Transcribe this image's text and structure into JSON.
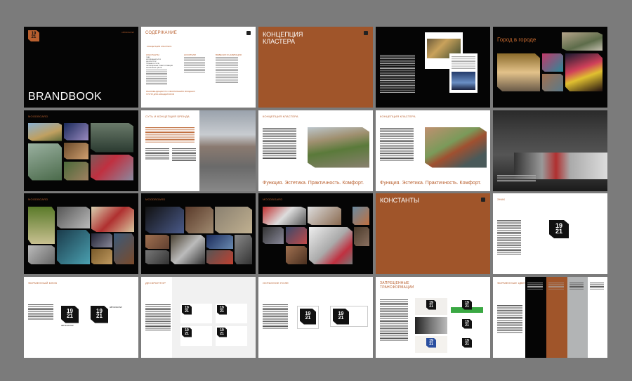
{
  "brand": {
    "logo_text": [
      "19",
      "21"
    ],
    "name": "АВТОКЛАСТЕР"
  },
  "colors": {
    "accent": "#b9602f",
    "rust": "#a0552a",
    "black": "#050505",
    "gray": "#b2b4b5"
  },
  "slides": {
    "cover": {
      "title": "BRANDBOOK",
      "tag": "АВТОКЛАСТЕР"
    },
    "toc": {
      "title": "СОДЕРЖАНИЕ",
      "concept": "КОНЦЕПЦИЯ КЛАСТЕРА",
      "sections": [
        {
          "label": "КОНСТАНТЫ",
          "items": [
            "ЗНАК",
            "ФИРМЕННЫЙ БЛОК",
            "ДЕСКРИПТОР",
            "ОХРАННОЕ ПОЛЕ",
            "ЗАПРЕЩЕННЫЕ ТРАНСФОРМАЦИИ",
            "ФИРМЕННЫЕ ЦВЕТА"
          ]
        },
        {
          "label": "НОСИТЕЛИ"
        },
        {
          "label": "ВЫВЕСКИ И НАВИГАЦИЯ"
        }
      ],
      "recommendations": "РЕКОМЕНДАЦИИ ПО ОФОРМЛЕНИЮ ВХОДНЫХ ГРУПП ДЛЯ АРЕНДАТОРОВ"
    },
    "concept_cover": {
      "title": "КОНЦЕПЦИЯ КЛАСТЕРА"
    },
    "city": {
      "title": "Город в городе"
    },
    "moodboard": {
      "title": "MOODBOARD"
    },
    "essence": {
      "title": "СУТЬ И КОНЦЕПЦИЯ БРЕНДА"
    },
    "concept1": {
      "title": "КОНЦЕПЦИЯ КЛАСТЕРА",
      "slogan": "Функция. Эстетика. Практичность. Комфорт."
    },
    "concept2": {
      "title": "КОНЦЕПЦИЯ КЛАСТЕРА",
      "slogan": "Функция. Эстетика. Практичность. Комфорт."
    },
    "constants": {
      "title": "КОНСТАНТЫ"
    },
    "sign": {
      "title": "ЗНАК"
    },
    "block": {
      "title": "ФИРМЕННЫЙ БЛОК"
    },
    "descriptor": {
      "title": "ДЕСКРИПТОР"
    },
    "safe_zone": {
      "title": "ОХРАННОЕ ПОЛЕ"
    },
    "forbidden": {
      "title": "ЗАПРЕЩЕННЫЕ ТРАНСФОРМАЦИИ"
    },
    "brand_colors": {
      "title": "ФИРМЕННЫЕ ЦВЕТА"
    }
  }
}
